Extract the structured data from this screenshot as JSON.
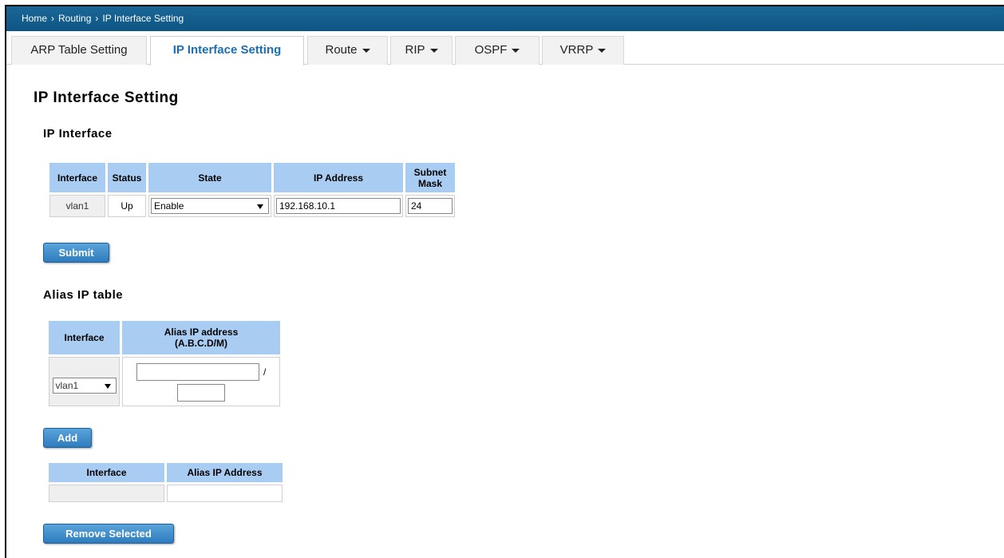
{
  "breadcrumb": {
    "items": [
      "Home",
      "Routing",
      "IP Interface Setting"
    ],
    "separator": "›"
  },
  "tabs": [
    {
      "label": "ARP Table Setting",
      "dropdown": false,
      "active": false
    },
    {
      "label": "IP Interface Setting",
      "dropdown": false,
      "active": true
    },
    {
      "label": "Route",
      "dropdown": true,
      "active": false
    },
    {
      "label": "RIP",
      "dropdown": true,
      "active": false
    },
    {
      "label": "OSPF",
      "dropdown": true,
      "active": false
    },
    {
      "label": "VRRP",
      "dropdown": true,
      "active": false
    }
  ],
  "page_title": "IP Interface Setting",
  "ip_interface": {
    "heading": "IP Interface",
    "headers": {
      "interface": "Interface",
      "status": "Status",
      "state": "State",
      "ip": "IP Address",
      "subnet": "Subnet Mask"
    },
    "row": {
      "interface": "vlan1",
      "status": "Up",
      "state": "Enable",
      "ip": "192.168.10.1",
      "subnet": "24"
    },
    "submit_label": "Submit"
  },
  "alias": {
    "heading": "Alias IP table",
    "headers": {
      "interface": "Interface",
      "alias": "Alias IP address\n(A.B.C.D/M)"
    },
    "interface_value": "vlan1",
    "ip_value": "",
    "slash": "/",
    "mask_value": "",
    "add_label": "Add"
  },
  "alias_list": {
    "headers": {
      "interface": "Interface",
      "alias": "Alias IP Address"
    },
    "remove_label": "Remove Selected"
  },
  "colors": {
    "header_bar": "#0d5584",
    "table_header": "#a9cdf2",
    "button": "#2d7cbf",
    "active_tab_text": "#1a6fb4"
  }
}
